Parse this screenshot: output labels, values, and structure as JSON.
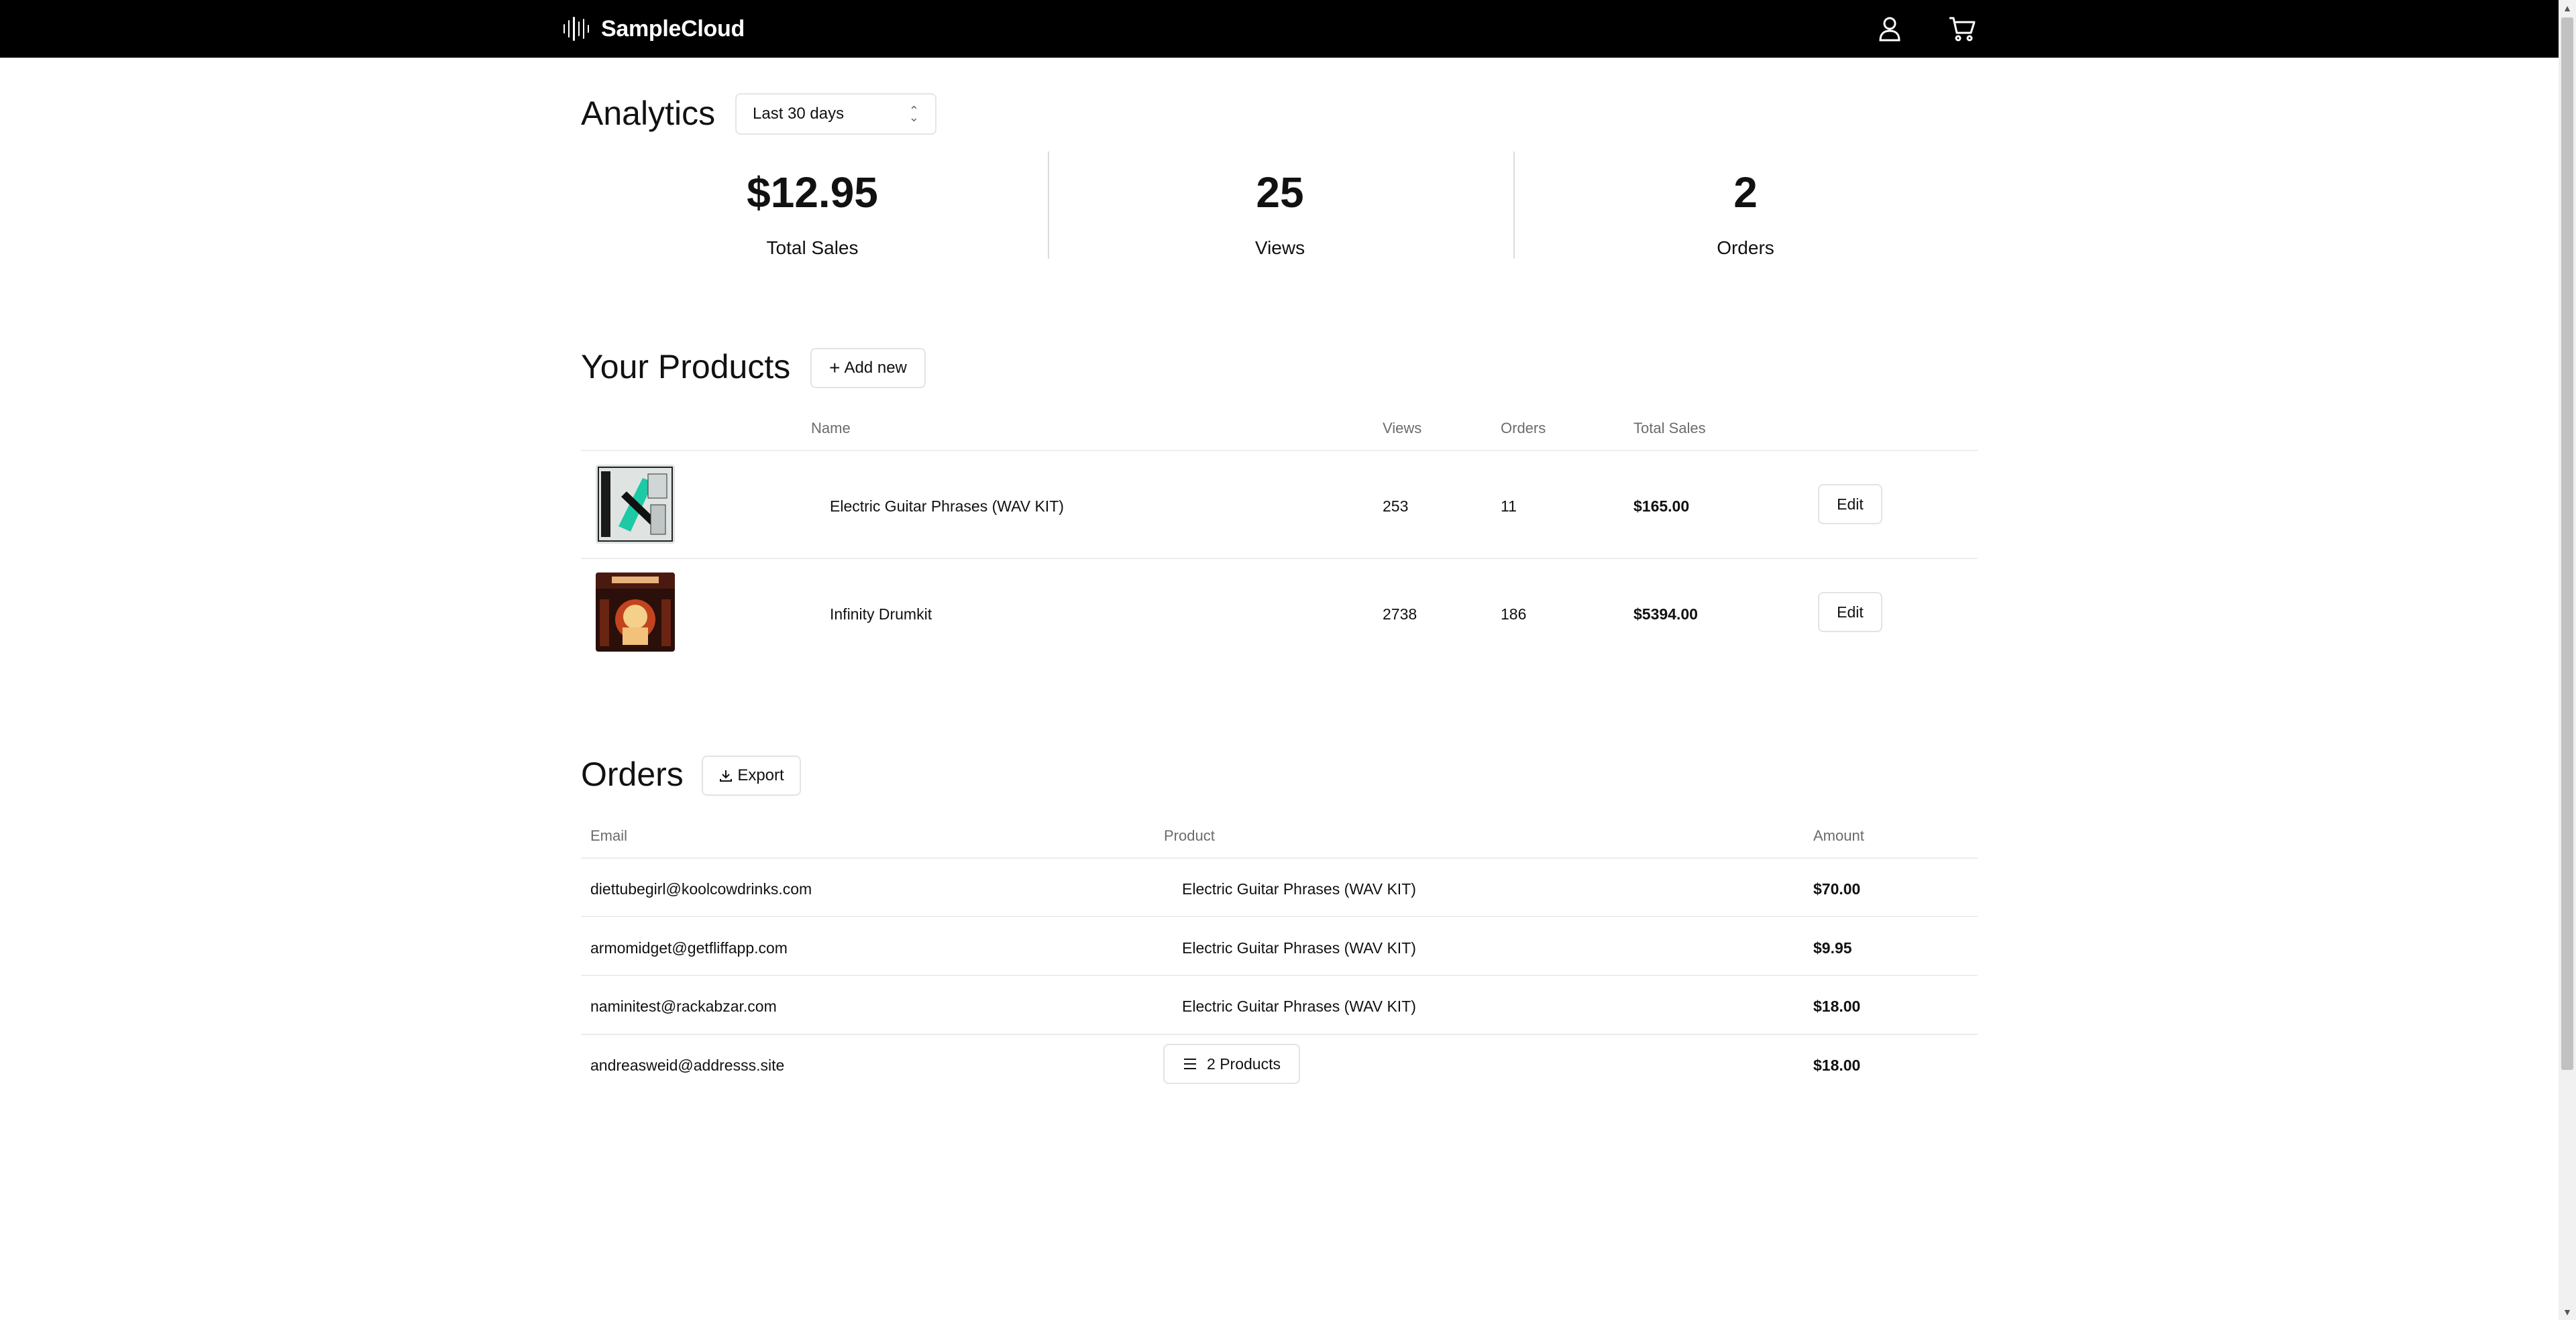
{
  "header": {
    "brand_name": "SampleCloud",
    "user_icon": "user-icon",
    "cart_icon": "cart-icon"
  },
  "analytics": {
    "title": "Analytics",
    "range_selected": "Last 30 days",
    "stats": [
      {
        "value": "$12.95",
        "label": "Total Sales"
      },
      {
        "value": "25",
        "label": "Views"
      },
      {
        "value": "2",
        "label": "Orders"
      }
    ]
  },
  "products": {
    "title": "Your Products",
    "add_label": "Add new",
    "columns": {
      "name": "Name",
      "views": "Views",
      "orders": "Orders",
      "total_sales": "Total Sales"
    },
    "rows": [
      {
        "name": "Electric Guitar Phrases (WAV KIT)",
        "views": "253",
        "orders": "11",
        "total_sales": "$165.00",
        "action": "Edit",
        "thumb": "cover-electric-guitar"
      },
      {
        "name": "Infinity Drumkit",
        "views": "2738",
        "orders": "186",
        "total_sales": "$5394.00",
        "action": "Edit",
        "thumb": "cover-infinity-drumkit"
      }
    ]
  },
  "orders": {
    "title": "Orders",
    "export_label": "Export",
    "columns": {
      "email": "Email",
      "product": "Product",
      "amount": "Amount"
    },
    "rows": [
      {
        "email": "diettubegirl@koolcowdrinks.com",
        "product": "Electric Guitar Phrases (WAV KIT)",
        "amount": "$70.00"
      },
      {
        "email": "armomidget@getfliffapp.com",
        "product": "Electric Guitar Phrases (WAV KIT)",
        "amount": "$9.95"
      },
      {
        "email": "naminitest@rackabzar.com",
        "product": "Electric Guitar Phrases (WAV KIT)",
        "amount": "$18.00"
      },
      {
        "email": "andreasweid@addresss.site",
        "product": "2 Products",
        "amount": "$18.00"
      }
    ]
  },
  "colors": {
    "topbar": "#000000",
    "border": "#e3e3e3",
    "muted_text": "#6b6b6b"
  }
}
